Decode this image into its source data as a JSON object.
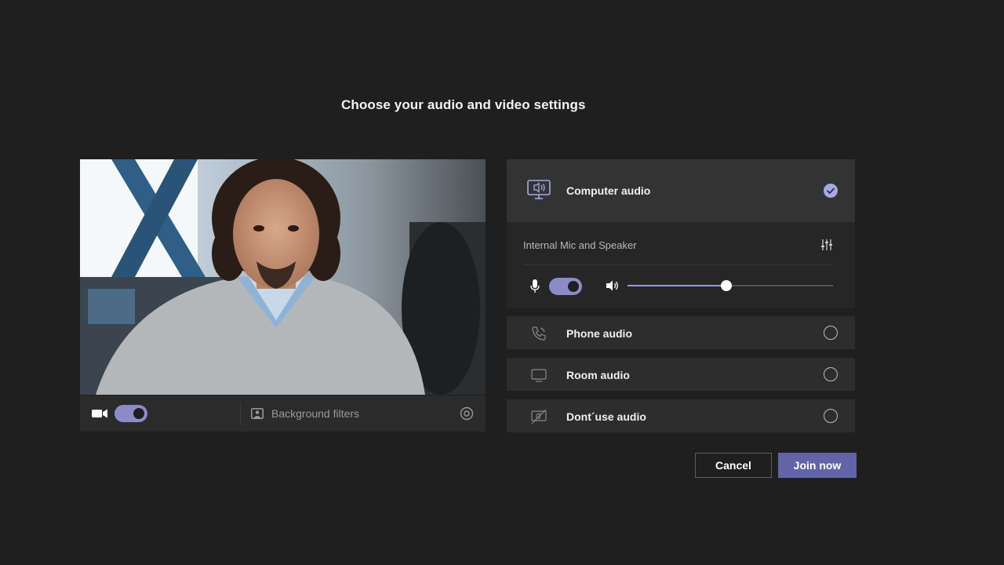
{
  "page": {
    "title": "Choose your audio and video settings"
  },
  "video_preview": {
    "camera_enabled": true,
    "background_filters_label": "Background filters"
  },
  "audio_options": {
    "computer_audio": {
      "label": "Computer audio",
      "selected": true,
      "device_name": "Internal Mic and Speaker",
      "mic_enabled": true,
      "speaker_volume_fraction": 0.48
    },
    "phone_audio": {
      "label": "Phone audio",
      "selected": false
    },
    "room_audio": {
      "label": "Room audio",
      "selected": false
    },
    "no_audio": {
      "label": "Dont´use audio",
      "selected": false
    }
  },
  "actions": {
    "cancel_label": "Cancel",
    "join_label": "Join now"
  },
  "colors": {
    "background": "#1f1f1f",
    "accent": "#6264a7",
    "toggle_on": "#8b8cc7",
    "check": "#a7a8e8"
  }
}
